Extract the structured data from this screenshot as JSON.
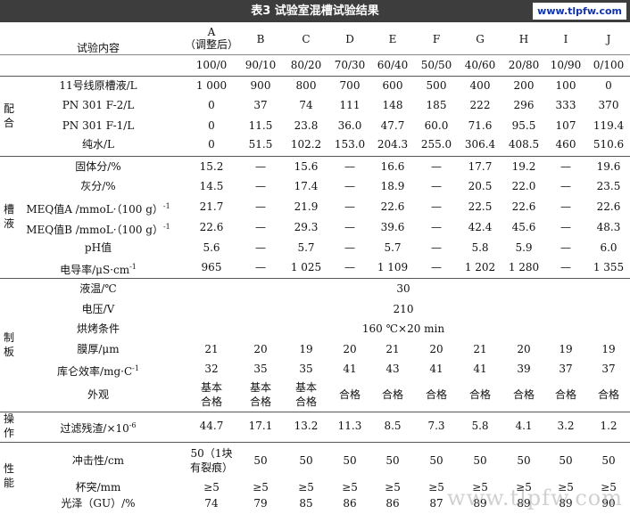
{
  "table": {
    "title": "表3  试验室混槽试验结果",
    "site": "www.tlpfw.com",
    "watermark": "www.tlpfw.com",
    "header": {
      "item_label": "试验内容",
      "columns": [
        "A",
        "B",
        "C",
        "D",
        "E",
        "F",
        "G",
        "H",
        "I",
        "J"
      ],
      "col_a_note": "（调整后）",
      "ratios": [
        "100/0",
        "90/10",
        "80/20",
        "70/30",
        "60/40",
        "50/50",
        "40/60",
        "20/80",
        "10/90",
        "0/100"
      ]
    },
    "sections": [
      {
        "label": "配合",
        "rows": [
          {
            "name": "11号线原槽液/L",
            "values": [
              "1 000",
              "900",
              "800",
              "700",
              "600",
              "500",
              "400",
              "200",
              "100",
              "0"
            ]
          },
          {
            "name": "PN 301 F-2/L",
            "values": [
              "0",
              "37",
              "74",
              "111",
              "148",
              "185",
              "222",
              "296",
              "333",
              "370"
            ]
          },
          {
            "name": "PN 301 F-1/L",
            "values": [
              "0",
              "11.5",
              "23.8",
              "36.0",
              "47.7",
              "60.0",
              "71.6",
              "95.5",
              "107",
              "119.4"
            ]
          },
          {
            "name": "纯水/L",
            "values": [
              "0",
              "51.5",
              "102.2",
              "153.0",
              "204.3",
              "255.0",
              "306.4",
              "408.5",
              "460",
              "510.6"
            ]
          }
        ]
      },
      {
        "label": "槽液",
        "rows": [
          {
            "name": "固体分/%",
            "values": [
              "15.2",
              "—",
              "15.6",
              "—",
              "16.6",
              "—",
              "17.7",
              "19.2",
              "—",
              "19.6"
            ]
          },
          {
            "name": "灰分/%",
            "values": [
              "14.5",
              "—",
              "17.4",
              "—",
              "18.9",
              "—",
              "20.5",
              "22.0",
              "—",
              "23.5"
            ]
          },
          {
            "name": "MEQ值A /mmoL·（100 g）",
            "sup": "-1",
            "values": [
              "21.7",
              "—",
              "21.9",
              "—",
              "22.6",
              "—",
              "22.5",
              "22.6",
              "—",
              "22.6"
            ]
          },
          {
            "name": "MEQ值B /mmoL·（100 g）",
            "sup": "-1",
            "values": [
              "22.6",
              "—",
              "29.3",
              "—",
              "39.6",
              "—",
              "42.4",
              "45.6",
              "—",
              "48.3"
            ]
          },
          {
            "name": "pH值",
            "values": [
              "5.6",
              "—",
              "5.7",
              "—",
              "5.7",
              "—",
              "5.8",
              "5.9",
              "—",
              "6.0"
            ]
          },
          {
            "name": "电导率/μS·cm",
            "sup": "-1",
            "values": [
              "965",
              "—",
              "1 025",
              "—",
              "1 109",
              "—",
              "1 202",
              "1 280",
              "—",
              "1 355"
            ]
          }
        ]
      },
      {
        "label": "制板",
        "spans": [
          {
            "name": "液温/℃",
            "value": "30"
          },
          {
            "name": "电压/V",
            "value": "210"
          },
          {
            "name": "烘烤条件",
            "value": "160 ℃×20 min"
          }
        ],
        "rows": [
          {
            "name": "膜厚/μm",
            "values": [
              "21",
              "20",
              "19",
              "20",
              "21",
              "20",
              "21",
              "20",
              "19",
              "19"
            ]
          },
          {
            "name": "库仑效率/mg·C",
            "sup": "-1",
            "values": [
              "32",
              "35",
              "35",
              "41",
              "43",
              "41",
              "41",
              "39",
              "37",
              "37"
            ]
          }
        ],
        "appearance": {
          "name": "外观",
          "values": [
            [
              "基本",
              "合格"
            ],
            [
              "基本",
              "合格"
            ],
            [
              "基本",
              "合格"
            ],
            [
              "合格"
            ],
            [
              "合格"
            ],
            [
              "合格"
            ],
            [
              "合格"
            ],
            [
              "合格"
            ],
            [
              "合格"
            ],
            [
              "合格"
            ]
          ]
        }
      },
      {
        "label": "操作",
        "rows": [
          {
            "name": "过滤残渣/×10",
            "sup": "-6",
            "values": [
              "44.7",
              "17.1",
              "13.2",
              "11.3",
              "8.5",
              "7.3",
              "5.8",
              "4.1",
              "3.2",
              "1.2"
            ]
          }
        ]
      },
      {
        "label": "性能",
        "impact": {
          "name": "冲击性/cm",
          "values": [
            [
              "50（1块",
              "有裂痕）"
            ],
            [
              "50"
            ],
            [
              "50"
            ],
            [
              "50"
            ],
            [
              "50"
            ],
            [
              "50"
            ],
            [
              "50"
            ],
            [
              "50"
            ],
            [
              "50"
            ],
            [
              "50"
            ]
          ]
        },
        "rows": [
          {
            "name": "杯突/mm",
            "values": [
              "≥5",
              "≥5",
              "≥5",
              "≥5",
              "≥5",
              "≥5",
              "≥5",
              "≥5",
              "≥5",
              "≥5"
            ]
          },
          {
            "name": "光泽（GU）/%",
            "values": [
              "74",
              "79",
              "85",
              "86",
              "86",
              "87",
              "89",
              "89",
              "89",
              "90"
            ]
          }
        ]
      }
    ]
  }
}
